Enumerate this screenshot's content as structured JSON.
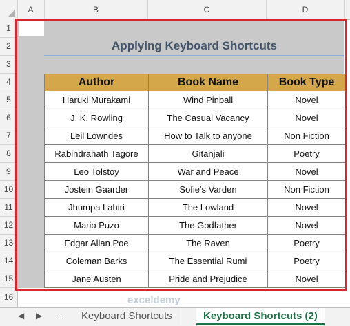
{
  "columns": [
    "A",
    "B",
    "C",
    "D"
  ],
  "rows": [
    "1",
    "2",
    "3",
    "4",
    "5",
    "6",
    "7",
    "8",
    "9",
    "10",
    "11",
    "12",
    "13",
    "14",
    "15",
    "16"
  ],
  "title": "Applying Keyboard Shortcuts",
  "table": {
    "headers": [
      "Author",
      "Book Name",
      "Book Type"
    ],
    "rows": [
      [
        "Haruki Murakami",
        "Wind Pinball",
        "Novel"
      ],
      [
        "J. K. Rowling",
        "The Casual Vacancy",
        "Novel"
      ],
      [
        "Leil Lowndes",
        "How to Talk to anyone",
        "Non Fiction"
      ],
      [
        "Rabindranath Tagore",
        "Gitanjali",
        "Poetry"
      ],
      [
        "Leo Tolstoy",
        "War and Peace",
        "Novel"
      ],
      [
        "Jostein Gaarder",
        "Sofie's Varden",
        "Non Fiction"
      ],
      [
        "Jhumpa Lahiri",
        "The Lowland",
        "Novel"
      ],
      [
        "Mario Puzo",
        "The Godfather",
        "Novel"
      ],
      [
        "Edgar Allan Poe",
        "The Raven",
        "Poetry"
      ],
      [
        "Coleman Barks",
        "The Essential Rumi",
        "Poetry"
      ],
      [
        "Jane Austen",
        "Pride and Prejudice",
        "Novel"
      ]
    ]
  },
  "tabs": {
    "prev": "◀",
    "next": "▶",
    "more": "...",
    "tab1": "Keyboard Shortcuts",
    "tab2": "Keyboard Shortcuts (2)"
  },
  "watermark": "exceldemy",
  "colors": {
    "header_fill": "#d4a74a",
    "selection_border": "#d9262c",
    "active_tab": "#1e7145"
  }
}
